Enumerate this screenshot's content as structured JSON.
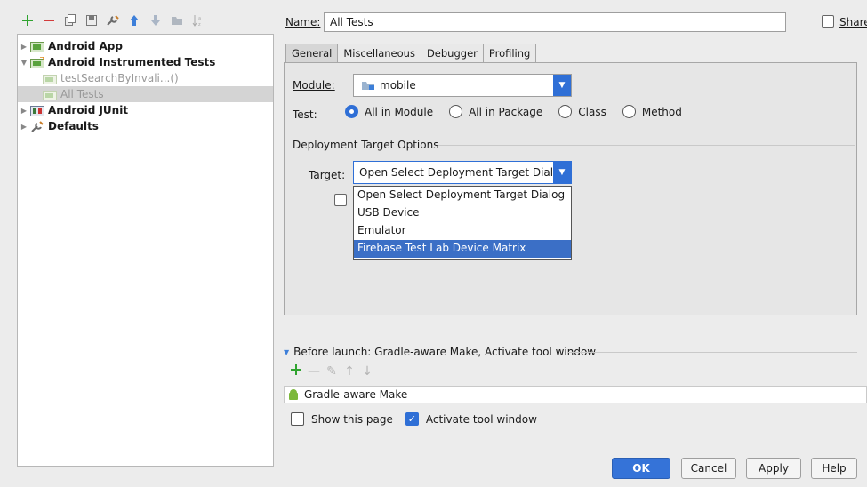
{
  "toolbar": {
    "icons": [
      "add-icon",
      "remove-icon",
      "copy-icon",
      "save-icon",
      "wrench-icon",
      "move-up-icon",
      "move-down-icon",
      "folder-icon",
      "sort-icon"
    ]
  },
  "tree": {
    "items": [
      {
        "label": "Android App"
      },
      {
        "label": "Android Instrumented Tests"
      },
      {
        "label": "testSearchByInvali...()"
      },
      {
        "label": "All Tests"
      },
      {
        "label": "Android JUnit"
      },
      {
        "label": "Defaults"
      }
    ]
  },
  "name": {
    "label": "Name:",
    "value": "All Tests"
  },
  "share": {
    "label": "Share",
    "checked": false
  },
  "tabs": [
    {
      "label": "General"
    },
    {
      "label": "Miscellaneous"
    },
    {
      "label": "Debugger"
    },
    {
      "label": "Profiling"
    }
  ],
  "module": {
    "label": "Module:",
    "value": "mobile"
  },
  "test": {
    "label": "Test:",
    "options": [
      "All in Module",
      "All in Package",
      "Class",
      "Method"
    ],
    "selected": "All in Module"
  },
  "deployment": {
    "title": "Deployment Target Options",
    "target_label": "Target:",
    "target_value": "Open Select Deployment Target Dialog",
    "options": [
      "Open Select Deployment Target Dialog",
      "USB Device",
      "Emulator",
      "Firebase Test Lab Device Matrix"
    ],
    "highlighted": "Firebase Test Lab Device Matrix"
  },
  "before_launch": {
    "title": "Before launch: Gradle-aware Make, Activate tool window",
    "items": [
      "Gradle-aware Make"
    ],
    "show_page_label": "Show this page",
    "show_page_checked": false,
    "activate_label": "Activate tool window",
    "activate_checked": true
  },
  "buttons": {
    "ok": "OK",
    "cancel": "Cancel",
    "apply": "Apply",
    "help": "Help"
  },
  "colors": {
    "accent": "#2f6fd6",
    "selection": "#3b6fc6",
    "green": "#2fa32f"
  }
}
